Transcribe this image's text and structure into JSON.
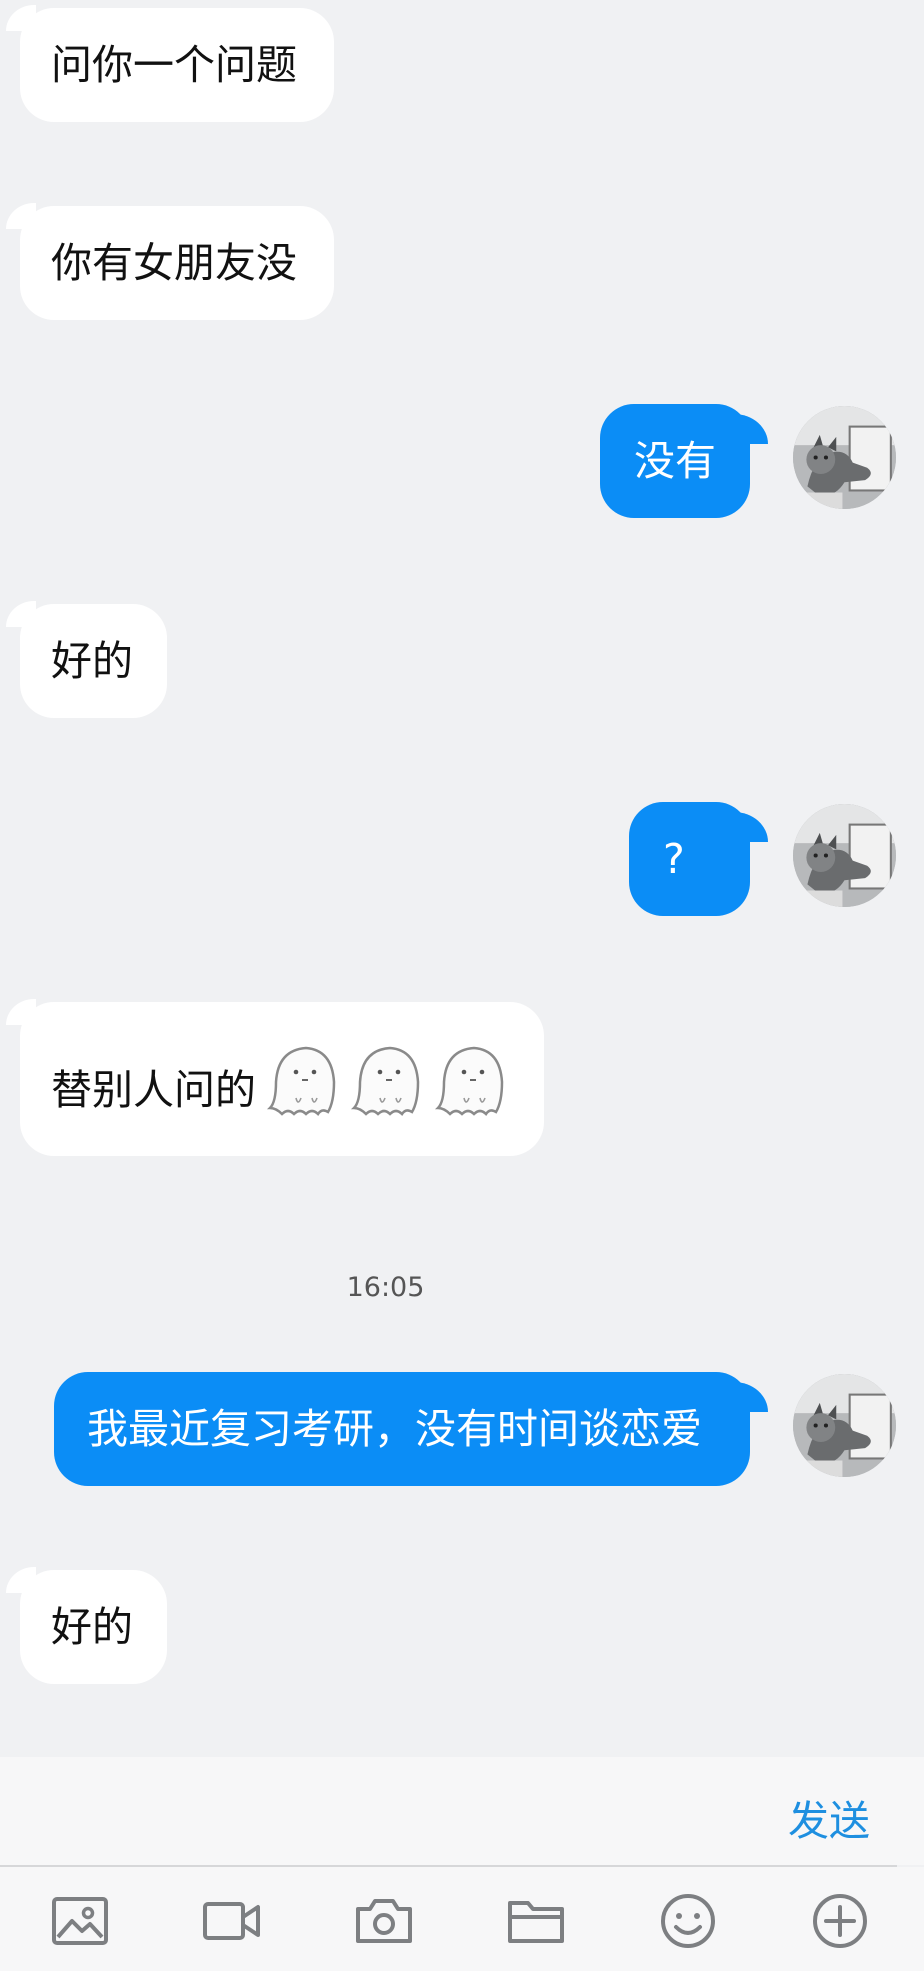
{
  "messages": [
    {
      "direction": "incoming",
      "text": "问你一个问题"
    },
    {
      "direction": "incoming",
      "text": "你有女朋友没"
    },
    {
      "direction": "outgoing",
      "text": "没有"
    },
    {
      "direction": "incoming",
      "text": "好的"
    },
    {
      "direction": "outgoing",
      "text": "?"
    },
    {
      "direction": "incoming",
      "text": "替别人问的",
      "emoji": [
        "ghost",
        "ghost",
        "ghost"
      ]
    },
    {
      "direction": "outgoing",
      "text": "我最近复习考研，没有时间谈恋爱"
    },
    {
      "direction": "incoming",
      "text": "好的"
    }
  ],
  "timestamp": "16:05",
  "input": {
    "send_label": "发送"
  },
  "toolbar": {
    "icons": [
      "image-icon",
      "video-icon",
      "camera-icon",
      "folder-icon",
      "emoji-icon",
      "plus-icon"
    ]
  },
  "colors": {
    "background": "#f0f1f3",
    "incoming_bubble": "#ffffff",
    "outgoing_bubble": "#0b8df6",
    "send_text": "#1e8fe0",
    "icon": "#7d7f82"
  }
}
